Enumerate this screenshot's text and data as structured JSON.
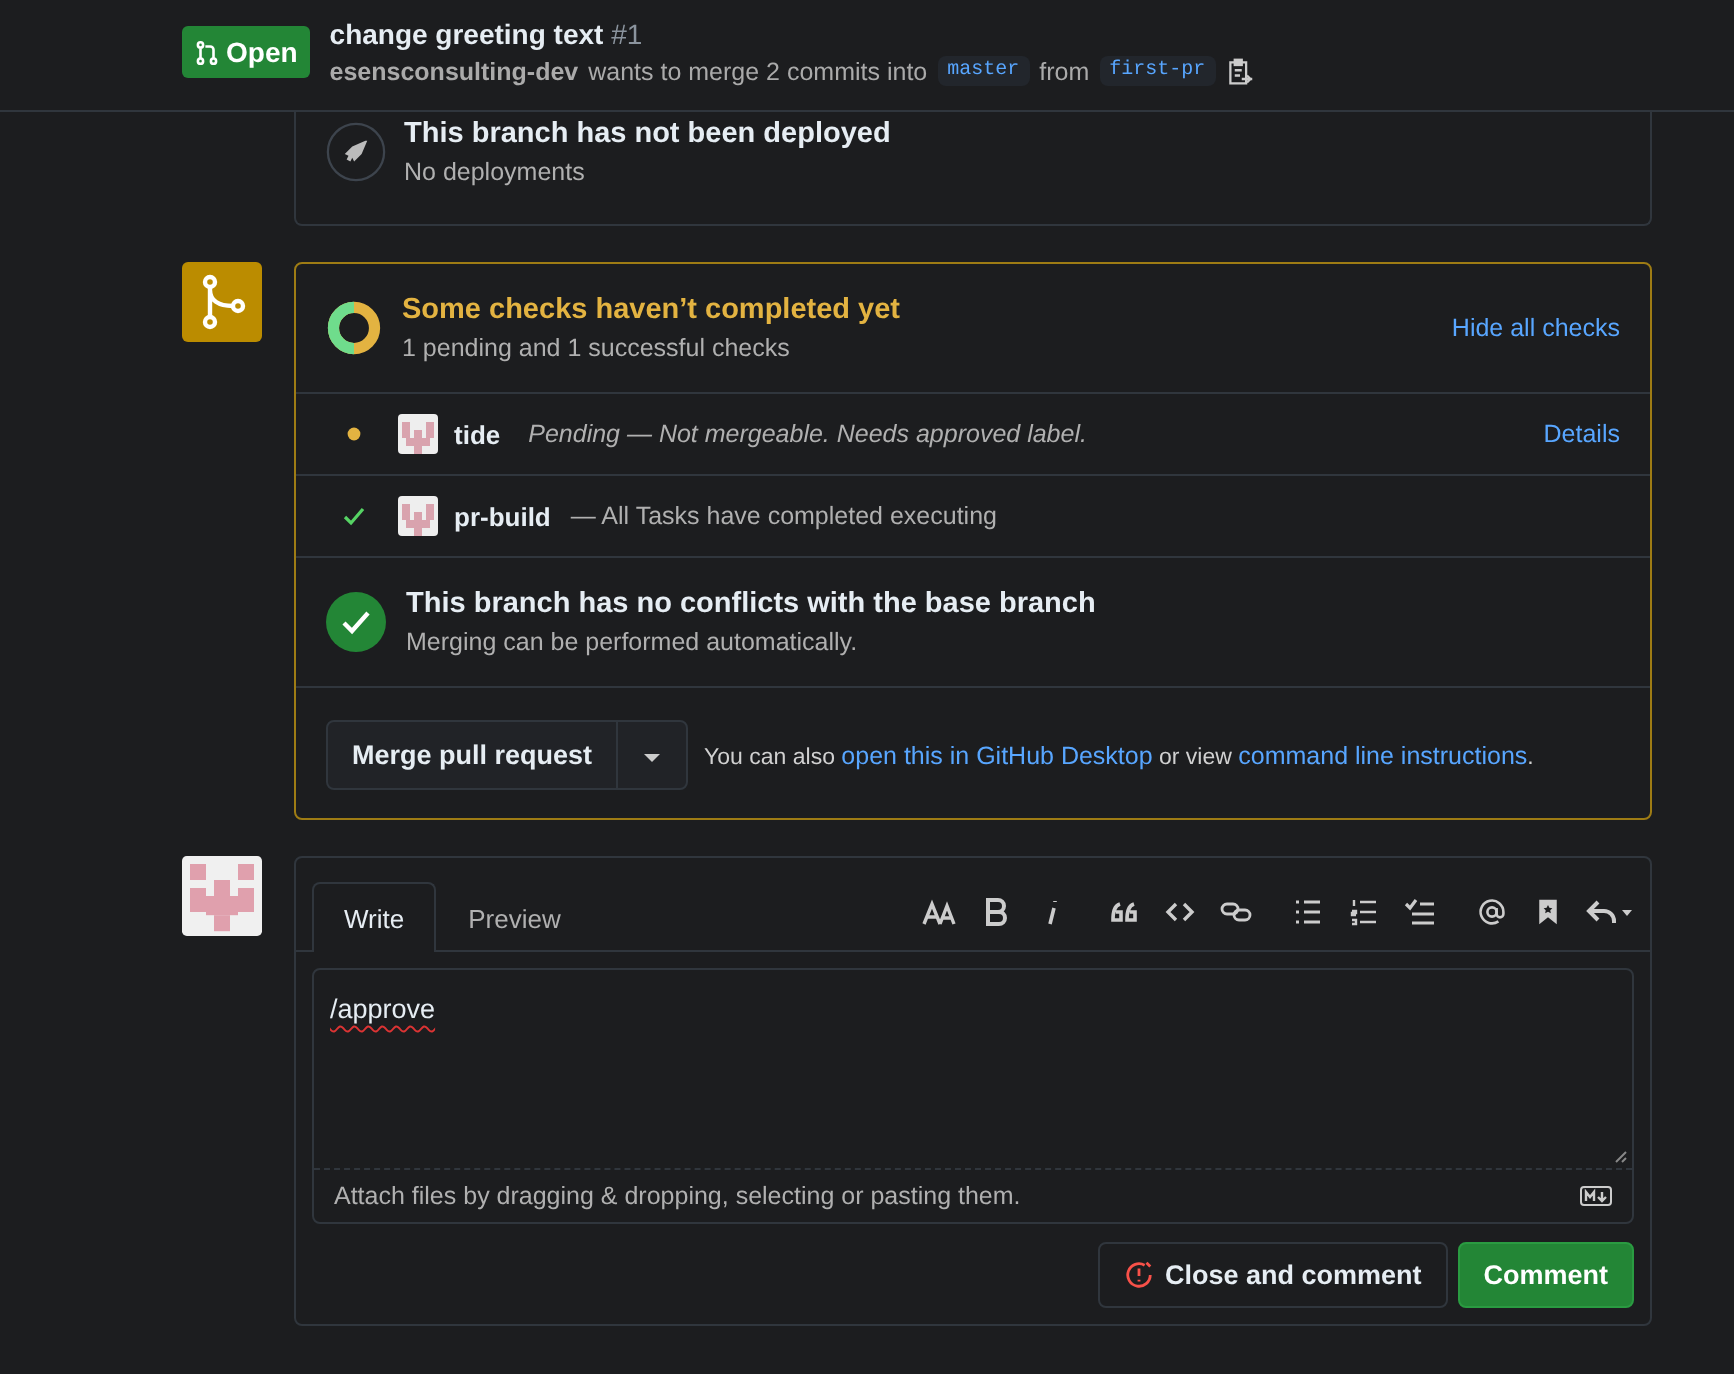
{
  "header": {
    "state": "Open",
    "title": "change greeting text",
    "number": "#1",
    "author": "esensconsulting-dev",
    "message": "wants to merge 2 commits into",
    "base": "master",
    "from": "from",
    "head": "first-pr"
  },
  "deployment": {
    "title": "This branch has not been deployed",
    "subtitle": "No deployments"
  },
  "checks": {
    "title": "Some checks haven’t completed yet",
    "summary": "1 pending and 1 successful checks",
    "toggle": "Hide all checks",
    "rows": [
      {
        "kind": "pending",
        "name": "tide",
        "status": "Pending — Not mergeable. Needs approved label.",
        "action": "Details"
      },
      {
        "kind": "success",
        "name": "pr-build",
        "status": "— All Tasks have completed executing"
      }
    ]
  },
  "merge": {
    "title": "This branch has no conflicts with the base branch",
    "subtitle": "Merging can be performed automatically.",
    "button": "Merge pull request",
    "hint_before": "You can also",
    "link_desktop": "open this in GitHub Desktop",
    "hint_middle": "or view",
    "link_cli": "command line instructions",
    "hint_end": "."
  },
  "comment": {
    "tabs": [
      {
        "label": "Write",
        "selected": true
      },
      {
        "label": "Preview",
        "selected": false
      }
    ],
    "toolbar": [
      {
        "kind": "heading"
      },
      {
        "kind": "bold"
      },
      {
        "kind": "italic"
      },
      {
        "kind": "quote"
      },
      {
        "kind": "code"
      },
      {
        "kind": "link"
      },
      {
        "kind": "bullets"
      },
      {
        "kind": "numbers"
      },
      {
        "kind": "tasks"
      },
      {
        "kind": "mention"
      },
      {
        "kind": "bookmark"
      },
      {
        "kind": "reply"
      }
    ],
    "value": "/approve",
    "attach": "Attach files by dragging & dropping, selecting or pasting them.",
    "close_button": "Close and comment",
    "submit_button": "Comment"
  }
}
